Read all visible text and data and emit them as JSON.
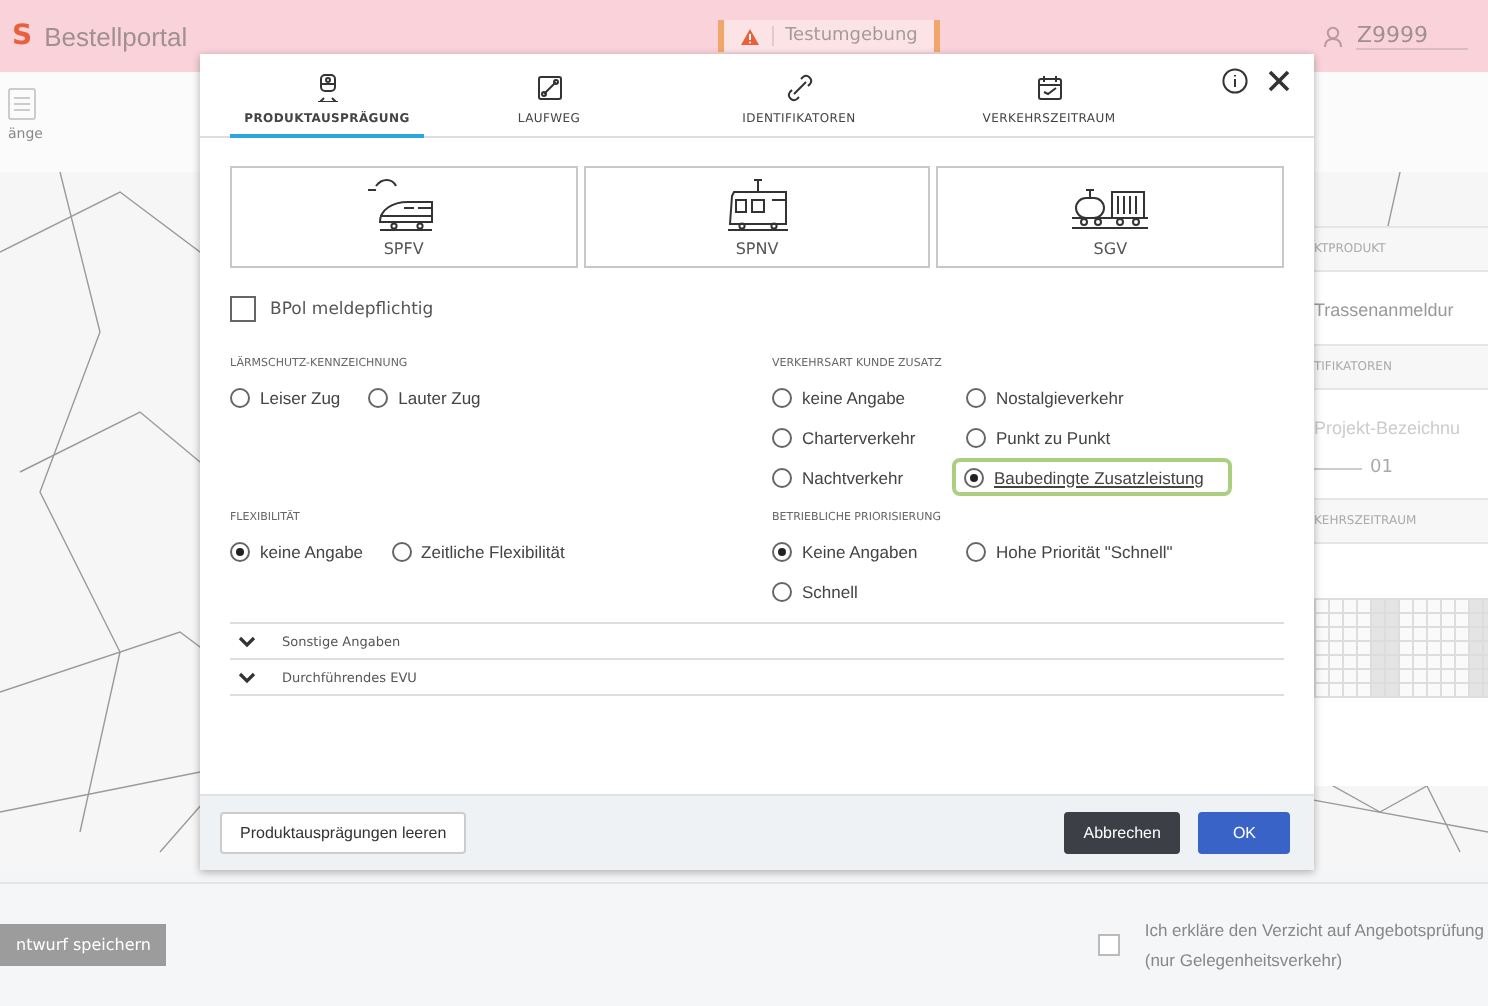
{
  "header": {
    "logo": "S",
    "title": "Bestellportal",
    "env_badge": "Testumgebung",
    "user": "Z9999"
  },
  "toolbar": {
    "label": "änge"
  },
  "side_panel": {
    "sections": [
      {
        "heading": "KTPRODUKT",
        "value": "Trassenanmeldur"
      },
      {
        "heading": "TIFIKATOREN",
        "placeholder": "Projekt-Bezeichnu",
        "value": "01"
      },
      {
        "heading": "KEHRSZEITRAUM"
      }
    ]
  },
  "bottom_bar": {
    "save_button": "ntwurf speichern",
    "waiver": {
      "checked": false,
      "lines": [
        "Ich erkläre den Verzicht auf Angebotsprüfung",
        "(nur Gelegenheitsverkehr)"
      ]
    }
  },
  "dialog": {
    "steps": [
      {
        "label": "PRODUKTAUSPRÄGUNG",
        "kind": "train",
        "selected": true
      },
      {
        "label": "LAUFWEG",
        "kind": "route",
        "selected": false
      },
      {
        "label": "IDENTIFIKATOREN",
        "kind": "link",
        "selected": false
      },
      {
        "label": "VERKEHRSZEITRAUM",
        "kind": "calendar",
        "selected": false
      }
    ],
    "products": [
      {
        "label": "SPFV",
        "kind": "highspeed",
        "selected": false
      },
      {
        "label": "SPNV",
        "kind": "regional",
        "selected": false
      },
      {
        "label": "SGV",
        "kind": "freight",
        "selected": false
      }
    ],
    "bpol": {
      "label": "BPol meldepflichtig",
      "checked": false
    },
    "groups": [
      {
        "heading": "LÄRMSCHUTZ-KENNZEICHNUNG",
        "kind": "inline",
        "options": [
          {
            "label": "Leiser Zug",
            "selected": false,
            "focused": false
          },
          {
            "label": "Lauter Zug",
            "selected": false,
            "focused": false
          }
        ]
      },
      {
        "heading": "VERKEHRSART KUNDE ZUSATZ",
        "kind": "grid",
        "options": [
          {
            "label": "keine Angabe",
            "selected": false,
            "focused": false
          },
          {
            "label": "Nostalgieverkehr",
            "selected": false,
            "focused": false
          },
          {
            "label": "Charterverkehr",
            "selected": false,
            "focused": false
          },
          {
            "label": "Punkt zu Punkt",
            "selected": false,
            "focused": false
          },
          {
            "label": "Nachtverkehr",
            "selected": false,
            "focused": false
          },
          {
            "label": "Baubedingte Zusatzleistung",
            "selected": true,
            "focused": true
          }
        ]
      },
      {
        "heading": "FLEXIBILITÄT",
        "kind": "inline",
        "options": [
          {
            "label": "keine Angabe",
            "selected": true,
            "focused": false
          },
          {
            "label": "Zeitliche Flexibilität",
            "selected": false,
            "focused": false
          }
        ]
      },
      {
        "heading": "BETRIEBLICHE PRIORISIERUNG",
        "kind": "grid",
        "options": [
          {
            "label": "Keine Angaben",
            "selected": true,
            "focused": false
          },
          {
            "label": "Hohe Priorität \"Schnell\"",
            "selected": false,
            "focused": false
          },
          {
            "label": "Schnell",
            "selected": false,
            "focused": false
          }
        ]
      }
    ],
    "accordions": [
      {
        "label": "Sonstige Angaben",
        "expanded": false
      },
      {
        "label": "Durchführendes EVU",
        "expanded": false
      }
    ],
    "clear_button": "Produktausprägungen leeren",
    "cancel_button": "Abbrechen",
    "ok_button": "OK"
  }
}
